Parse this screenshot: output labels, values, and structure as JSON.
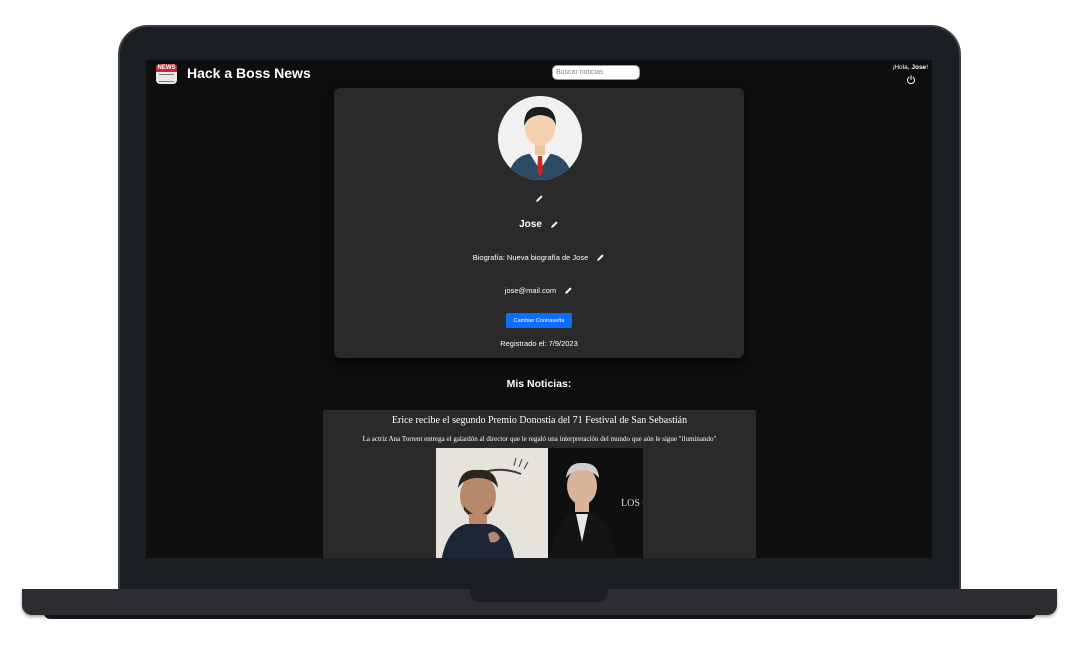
{
  "header": {
    "site_title": "Hack a Boss News",
    "logo_text": "NEWS",
    "search_placeholder": "Buscar noticias",
    "greeting_prefix": "¡Hola, ",
    "greeting_name": "Jose",
    "greeting_suffix": "!"
  },
  "profile": {
    "username": "Jose",
    "bio": "Biografía: Nueva biografía de Jose",
    "email": "jose@mail.com",
    "change_password_label": "Cambiar Contraseña",
    "registered": "Registrado el: 7/9/2023"
  },
  "my_news": {
    "heading": "Mis Noticias:",
    "items": [
      {
        "title": "Erice recibe el segundo Premio Donostia del 71 Festival de San Sebastián",
        "subtitle": "La actriz Ana Torrent entrega el galardón al director que le regaló una interpretación del mundo que aún le sigue \"iluminando\"",
        "image_text": "LOS OJOS"
      }
    ]
  },
  "colors": {
    "background": "#0e0e0e",
    "card": "#2a2a2a",
    "accent_button": "#0d6efd",
    "text": "#ffffff"
  },
  "icons": [
    "logout-icon",
    "edit-icon",
    "avatar",
    "news-logo"
  ]
}
